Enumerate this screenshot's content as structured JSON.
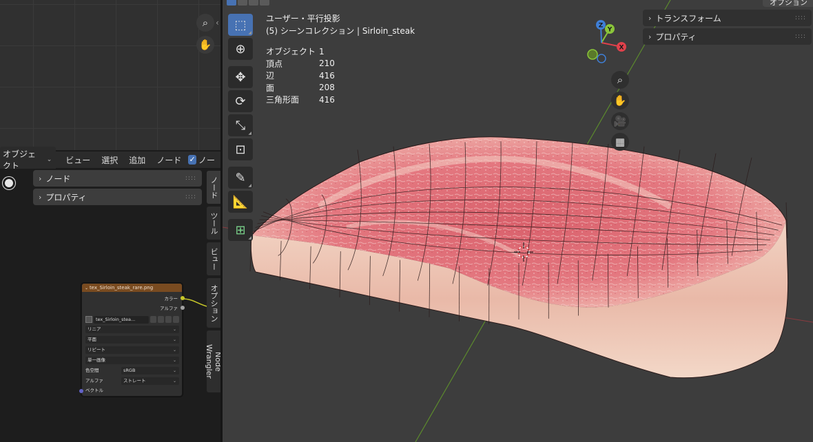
{
  "node_editor": {
    "header": {
      "mode": "オブジェクト",
      "menu": [
        "ビュー",
        "選択",
        "追加",
        "ノード"
      ],
      "checkbox_label": "ノー"
    },
    "sidebar_panels": [
      {
        "label": "ノード"
      },
      {
        "label": "プロパティ"
      }
    ],
    "vertical_tabs": [
      "ノード",
      "ツール",
      "ビュー",
      "オプション",
      "Node Wrangler"
    ],
    "image_node": {
      "title": "tex_Sirloin_steak_rare.png",
      "outputs": [
        "カラー",
        "アルファ"
      ],
      "image_name": "tex_Sirloin_stea...",
      "interpolation": "リニア",
      "projection": "平面",
      "extension": "リピート",
      "source": "単一画像",
      "colorspace_label": "色空間",
      "colorspace_value": "sRGB",
      "alpha_label": "アルファ",
      "alpha_value": "ストレート",
      "input": "ベクトル",
      "colors": {
        "header": "#794b20",
        "color_socket": "#c7c729",
        "alpha_socket": "#a1a1a1",
        "vector_socket": "#6363c7"
      }
    }
  },
  "viewport": {
    "view_name": "ユーザー・平行投影",
    "collection_line": "(5) シーンコレクション | Sirloin_steak",
    "stats": [
      {
        "label": "オブジェクト",
        "value": "1"
      },
      {
        "label": "頂点",
        "value": "210"
      },
      {
        "label": "辺",
        "value": "416"
      },
      {
        "label": "面",
        "value": "208"
      },
      {
        "label": "三角形面",
        "value": "416"
      }
    ],
    "n_panel": [
      {
        "label": "トランスフォーム"
      },
      {
        "label": "プロパティ"
      }
    ],
    "options_label": "オプション",
    "gizmo": {
      "x": "X",
      "y": "Y",
      "z": "Z"
    },
    "toolbar": [
      "select-box",
      "cursor",
      "move",
      "rotate",
      "scale",
      "transform",
      "annotate",
      "measure",
      "add-cube"
    ],
    "nav_icons": [
      "zoom-icon",
      "hand-icon",
      "camera-icon",
      "grid-icon"
    ],
    "colors": {
      "accent": "#4772b3",
      "x_axis": "#e0414b",
      "y_axis": "#8ac53a",
      "z_axis": "#3f7fd6"
    }
  }
}
